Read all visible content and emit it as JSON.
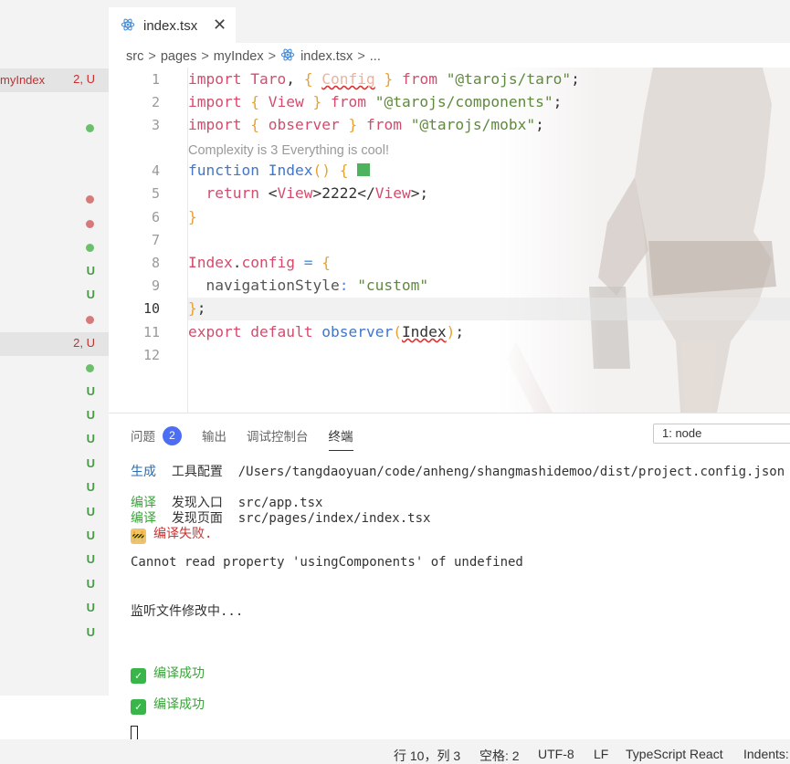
{
  "tabs": [
    {
      "label": "index.tsx",
      "close": "✕"
    }
  ],
  "breadcrumb": {
    "items": [
      "src",
      "pages",
      "myIndex",
      "index.tsx",
      "..."
    ],
    "sep": ">"
  },
  "sidebar": {
    "rows": [
      {
        "label": "myIndex",
        "status": "2, U",
        "kind": "err",
        "selected": true
      },
      {
        "dot": "#6cbf6c"
      },
      {
        "dot": "#d67b7b"
      },
      {
        "dot": "#d67b7b"
      },
      {
        "dot": "#6cbf6c"
      },
      {
        "status": "U",
        "kind": "u"
      },
      {
        "status": "U",
        "kind": "u"
      },
      {
        "dot": "#d67b7b"
      },
      {
        "status": "2, U",
        "kind": "err",
        "selected": true
      },
      {
        "dot": "#6cbf6c"
      },
      {
        "status": "U",
        "kind": "u"
      },
      {
        "status": "U",
        "kind": "u"
      },
      {
        "status": "U",
        "kind": "u"
      },
      {
        "status": "U",
        "kind": "u"
      },
      {
        "status": "U",
        "kind": "u"
      },
      {
        "status": "U",
        "kind": "u"
      },
      {
        "status": "U",
        "kind": "u"
      },
      {
        "status": "U",
        "kind": "u"
      },
      {
        "status": "U",
        "kind": "u"
      },
      {
        "status": "U",
        "kind": "u"
      },
      {
        "status": "U",
        "kind": "u"
      }
    ]
  },
  "editor": {
    "line_numbers": [
      "1",
      "2",
      "3",
      "4",
      "5",
      "6",
      "7",
      "8",
      "9",
      "10",
      "11",
      "12"
    ],
    "current_line": "10",
    "codelens": "Complexity is 3 Everything is cool!",
    "code": {
      "l1": {
        "a": "import",
        "b": "Taro",
        "c": ",",
        "d": "{",
        "e": "Config",
        "f": "}",
        "g": "from",
        "h": "\"@tarojs/taro\"",
        "i": ";"
      },
      "l2": {
        "a": "import",
        "b": "{",
        "c": "View",
        "d": "}",
        "e": "from",
        "f": "\"@tarojs/components\"",
        "g": ";"
      },
      "l3": {
        "a": "import",
        "b": "{",
        "c": "observer",
        "d": "}",
        "e": "from",
        "f": "\"@tarojs/mobx\"",
        "g": ";"
      },
      "l4": {
        "a": "function",
        "b": "Index",
        "c": "()",
        "d": "{"
      },
      "l5": {
        "a": "return",
        "b": "<",
        "c": "View",
        "d": ">2222</",
        "e": "View",
        "f": ">;"
      },
      "l6": {
        "a": "}"
      },
      "l8": {
        "a": "Index",
        "b": ".",
        "c": "config",
        "d": "=",
        "e": "{"
      },
      "l9": {
        "a": "navigationStyle",
        "b": ":",
        "c": "\"custom\""
      },
      "l10": {
        "a": "}",
        "b": ";"
      },
      "l11": {
        "a": "export",
        "b": "default",
        "c": "observer",
        "d": "(",
        "e": "Index",
        "f": ")",
        "g": ";"
      }
    }
  },
  "panel": {
    "tabs": [
      "问题",
      "输出",
      "调试控制台",
      "终端"
    ],
    "problems_count": "2",
    "terminal_select": "1: node",
    "terminal": {
      "l1": {
        "tag": "生成",
        "label": "工具配置",
        "value": "/Users/tangdaoyuan/code/anheng/shangmashidemoo/dist/project.config.json"
      },
      "l2": {
        "tag": "编译",
        "label": "发现入口",
        "value": "src/app.tsx"
      },
      "l3": {
        "tag": "编译",
        "label": "发现页面",
        "value": "src/pages/index/index.tsx"
      },
      "l4": {
        "icon": "🚧",
        "text": "编译失败."
      },
      "l5": "Cannot read property 'usingComponents' of undefined",
      "l6": "监听文件修改中...",
      "l7": {
        "icon": "✓",
        "text": "编译成功"
      },
      "l8": {
        "icon": "✓",
        "text": "编译成功"
      }
    }
  },
  "statusbar": {
    "position": "行 10，列 3",
    "spaces": "空格: 2",
    "encoding": "UTF-8",
    "eol": "LF",
    "language": "TypeScript React",
    "indents": "Indents:"
  },
  "colors": {
    "accent": "#4c6ef5",
    "error": "#c72e2e",
    "untracked": "#4a9a4a"
  }
}
